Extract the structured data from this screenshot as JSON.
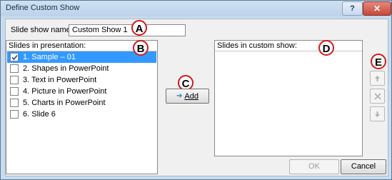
{
  "window": {
    "title": "Define Custom Show",
    "help_label": "?",
    "close_label": "✕"
  },
  "show_name": {
    "label": "Slide show name:",
    "value": "Custom Show 1"
  },
  "left_list": {
    "header": "Slides in presentation:",
    "items": [
      {
        "label": "1. Sample – 01",
        "checked": true,
        "selected": true
      },
      {
        "label": "2. Shapes in PowerPoint",
        "checked": false
      },
      {
        "label": "3. Text in PowerPoint",
        "checked": false
      },
      {
        "label": "4. Picture in PowerPoint",
        "checked": false
      },
      {
        "label": "5. Charts in PowerPoint",
        "checked": false
      },
      {
        "label": "6. Slide 6",
        "checked": false
      }
    ]
  },
  "right_list": {
    "header": "Slides in custom show:"
  },
  "buttons": {
    "add": "Add",
    "ok": "OK",
    "cancel": "Cancel"
  },
  "markers": {
    "a": "A",
    "b": "B",
    "c": "C",
    "d": "D",
    "e": "E"
  },
  "colors": {
    "marker_ring": "#d11a1a",
    "selection": "#3399ff"
  }
}
